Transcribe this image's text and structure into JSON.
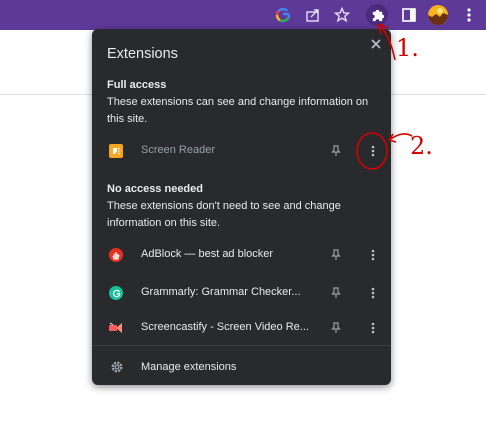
{
  "toolbar": {
    "icons": [
      "google-lens-icon",
      "share-icon",
      "star-icon",
      "extensions-puzzle-icon",
      "side-panel-icon",
      "profile-avatar",
      "more-vert-icon"
    ]
  },
  "popup": {
    "title": "Extensions",
    "full_access": {
      "heading": "Full access",
      "description": "These extensions can see and change information on this site.",
      "items": [
        {
          "name": "Screen Reader",
          "icon": "screen-reader-icon",
          "icon_color": "#f5a623"
        }
      ]
    },
    "no_access": {
      "heading": "No access needed",
      "description": "These extensions don't need to see and change information on this site.",
      "items": [
        {
          "name": "AdBlock — best ad blocker",
          "icon": "adblock-icon",
          "icon_color": "#e8321f"
        },
        {
          "name": "Grammarly: Grammar Checker...",
          "icon": "grammarly-icon",
          "icon_color": "#15c39a"
        },
        {
          "name": "Screencastify - Screen Video Re...",
          "icon": "screencastify-icon",
          "icon_color": "#ff5c5c"
        }
      ]
    },
    "manage_label": "Manage extensions"
  },
  "annotations": {
    "step1": "1.",
    "step2": "2."
  },
  "colors": {
    "toolbar": "#5e3a98",
    "popup_bg": "#292a2d",
    "annotation": "#d40000"
  }
}
